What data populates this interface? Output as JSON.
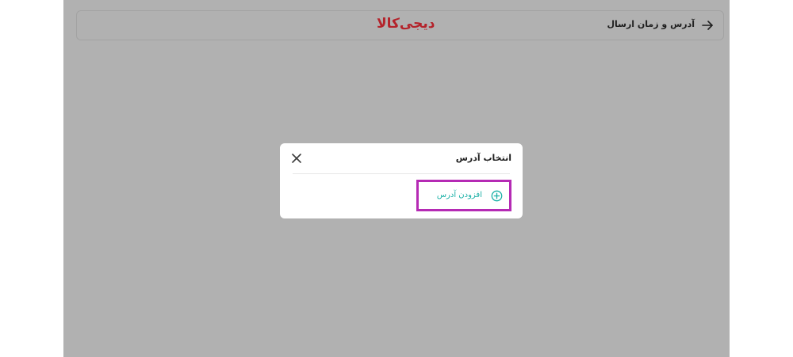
{
  "header": {
    "title": "آدرس و زمان ارسال",
    "logo_text": "دیجی‌کالا"
  },
  "modal": {
    "title": "انتخاب آدرس",
    "add_address_label": "افزودن آدرس"
  },
  "icons": {
    "back": "arrow-right-icon",
    "close": "close-icon",
    "add": "plus-circle-icon"
  },
  "colors": {
    "overlay": "#b1b1b1",
    "brand": "#b4232b",
    "accent": "#19b0a6",
    "highlight": "#b52ab4"
  }
}
